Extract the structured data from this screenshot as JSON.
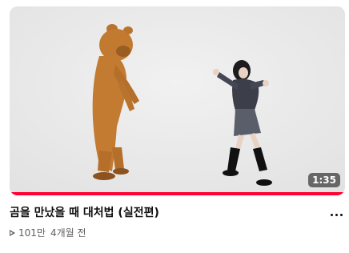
{
  "video": {
    "title": "곰을 만났을 때 대처법 (실전편)",
    "duration": "1:35",
    "views": "101만",
    "published": "4개월 전",
    "progress": 1.0,
    "accent_color": "#ff0033"
  },
  "icons": {
    "play": "play-triangle-icon",
    "more": "more-vertical-dots-icon"
  }
}
